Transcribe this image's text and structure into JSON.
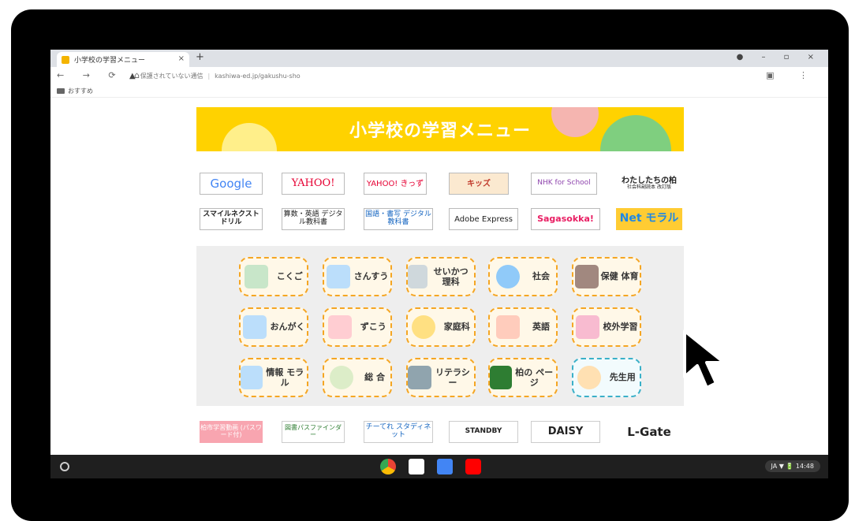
{
  "browser": {
    "tab_title": "小学校の学習メニュー",
    "tab_close": "×",
    "new_tab": "+",
    "address_warning": "保護されていない通信",
    "address_url": "kashiwa-ed.jp/gakushu-sho",
    "bookmark_label": "おすすめ"
  },
  "page": {
    "title": "小学校の学習メニュー"
  },
  "links_row1": [
    {
      "label": "Google",
      "color": "#4285f4"
    },
    {
      "label": "YAHOO!",
      "color": "#e60033"
    },
    {
      "label": "YAHOO! きっず",
      "color": "#e60033"
    },
    {
      "label": "キッズ",
      "color": "#c0392b"
    },
    {
      "label": "NHK for School",
      "color": "#8e44ad"
    },
    {
      "label": "わたしたちの柏",
      "color": "#333333"
    }
  ],
  "links_row1_sub": "社会科副読本 改訂版",
  "links_row2": [
    {
      "label": "スマイルネクスト ドリル",
      "color": "#d32f2f"
    },
    {
      "label": "算数・英語 デジタル教科書",
      "color": "#1565c0"
    },
    {
      "label": "国語・書写 デジタル教科書",
      "color": "#1565c0"
    },
    {
      "label": "Adobe Express",
      "color": "#000000"
    },
    {
      "label": "Sagasokka!",
      "color": "#e91e63"
    },
    {
      "label": "Net モラル",
      "color": "#1e88e5"
    }
  ],
  "subjects": [
    {
      "label": "こくご",
      "color": "#8bc34a"
    },
    {
      "label": "さんすう",
      "color": "#1e88e5"
    },
    {
      "label": "せいかつ 理科",
      "color": "#455a64"
    },
    {
      "label": "社会",
      "color": "#1e88e5"
    },
    {
      "label": "保健 体育",
      "color": "#8d5524"
    },
    {
      "label": "おんがく",
      "color": "#1565c0"
    },
    {
      "label": "ずこう",
      "color": "#d32f2f"
    },
    {
      "label": "家庭科",
      "color": "#f9a825"
    },
    {
      "label": "英語",
      "color": "#e53935"
    },
    {
      "label": "校外学習",
      "color": "#ec407a"
    },
    {
      "label": "情報 モラル",
      "color": "#42a5f5"
    },
    {
      "label": "総 合",
      "color": "#7cb342"
    },
    {
      "label": "リテラシー",
      "color": "#1e88e5"
    },
    {
      "label": "柏の ページ",
      "color": "#2e7d32"
    },
    {
      "label": "先生用",
      "color": "#3ab0c8"
    }
  ],
  "bottom_links": [
    {
      "label": "柏市学習動画 (パスワード付)",
      "color": "#f8a5b0"
    },
    {
      "label": "図書パスファインダー",
      "color": "#2e7d32"
    },
    {
      "label": "チーてれ スタディネット",
      "color": "#1565c0"
    },
    {
      "label": "STANDBY",
      "color": "#333333"
    },
    {
      "label": "DAISY",
      "color": "#d32f2f"
    },
    {
      "label": "L-Gate",
      "color": "#222222"
    }
  ],
  "shelf": {
    "tray_text": "JA  ▼ 🔋 14:48"
  }
}
